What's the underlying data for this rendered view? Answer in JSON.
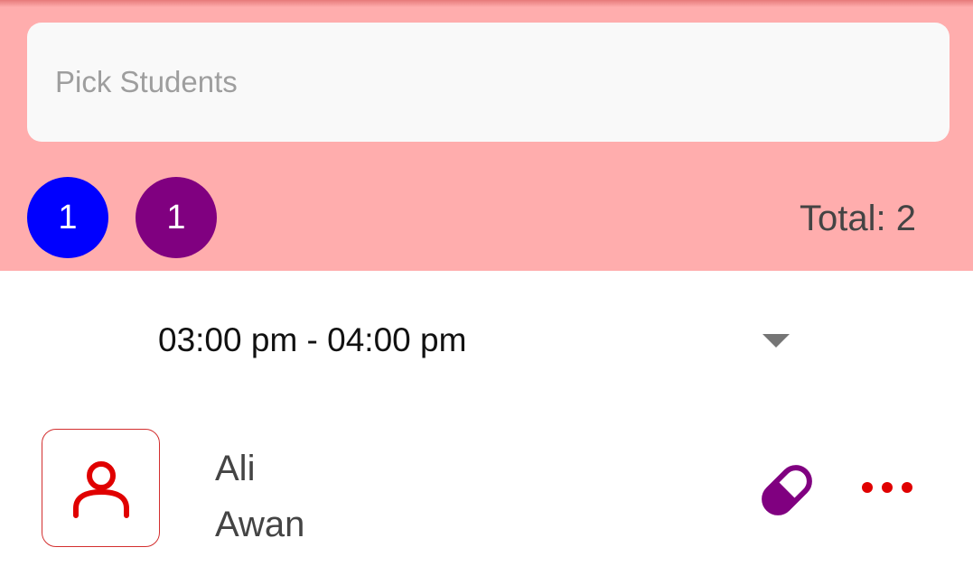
{
  "search": {
    "placeholder": "Pick Students",
    "value": ""
  },
  "badges": [
    {
      "count": "1",
      "color": "#0000ff"
    },
    {
      "count": "1",
      "color": "#800080"
    }
  ],
  "total_label": "Total: 2",
  "time_slot": {
    "selected": "03:00 pm - 04:00 pm"
  },
  "students": [
    {
      "first_name": "Ali",
      "last_name": "Awan",
      "avatar_icon": "person-icon",
      "action_icon": "pill-icon",
      "menu_icon": "more-horizontal-icon"
    }
  ],
  "colors": {
    "header_bg": "#ffadad",
    "accent_red": "#e00000",
    "purple": "#800080"
  }
}
